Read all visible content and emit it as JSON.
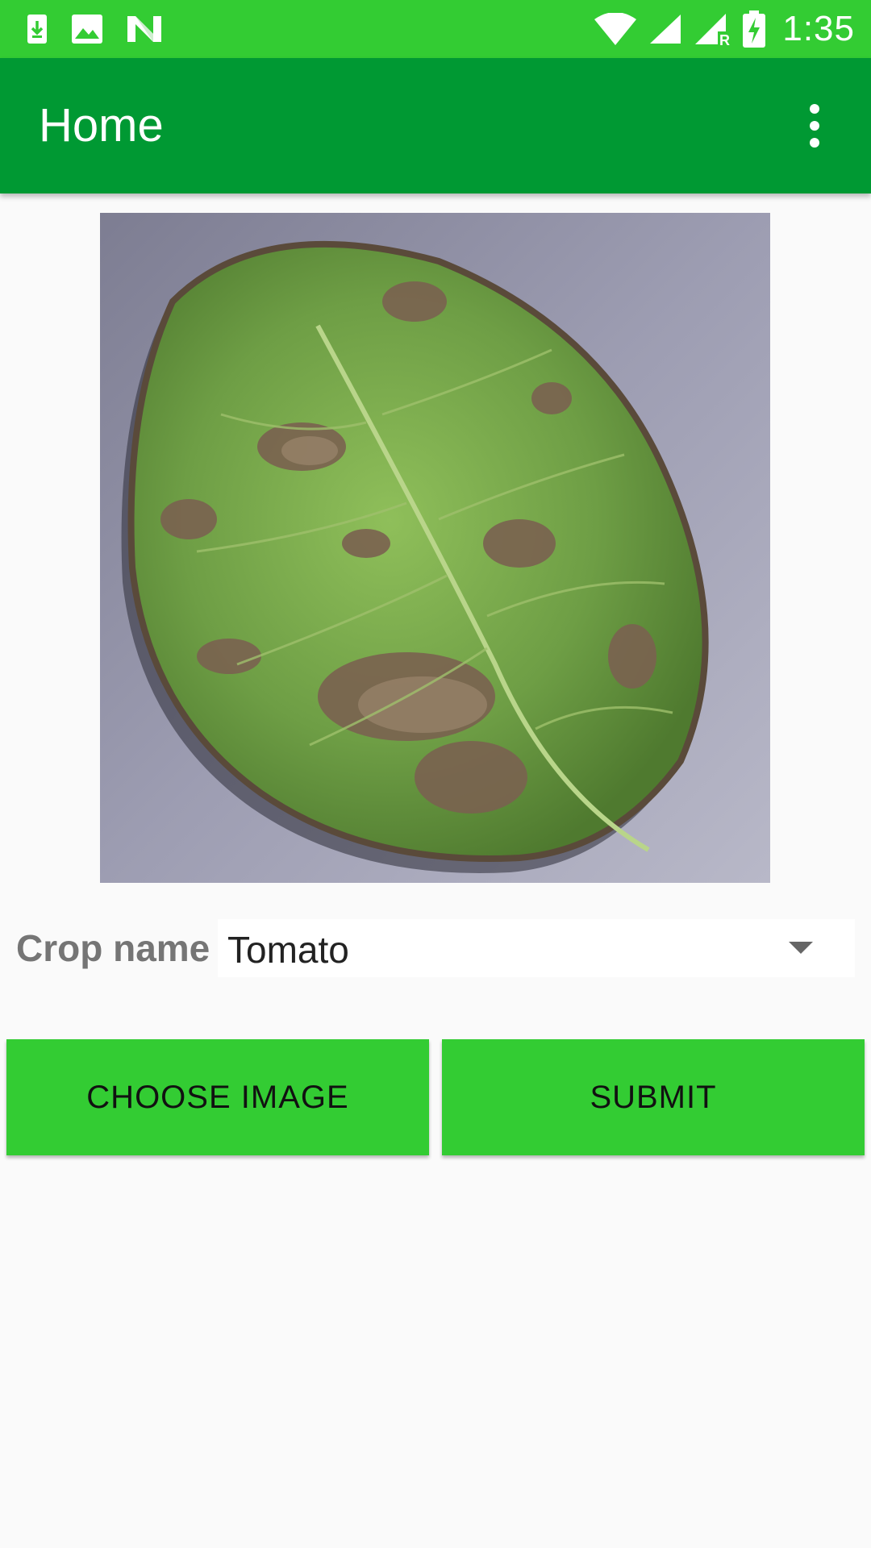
{
  "status_bar": {
    "time": "1:35",
    "left_icons": [
      "download-icon",
      "image-icon",
      "n-logo-icon"
    ],
    "right_icons": [
      "wifi-icon",
      "signal-icon",
      "signal-roaming-icon",
      "battery-charging-icon"
    ],
    "roaming_letter": "R",
    "color": "#33cc33"
  },
  "app_bar": {
    "title": "Home",
    "color": "#009933",
    "menu_icon": "overflow-menu-icon"
  },
  "main": {
    "image_subject": "leaf-image",
    "crop_label": "Crop name",
    "crop_value": "Tomato",
    "buttons": {
      "choose_image": "CHOOSE IMAGE",
      "submit": "SUBMIT"
    },
    "button_color": "#33cc33"
  }
}
